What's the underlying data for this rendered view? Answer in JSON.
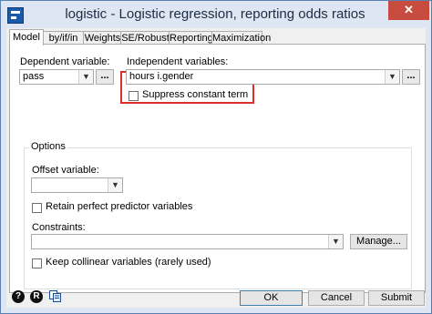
{
  "window": {
    "title": "logistic - Logistic regression, reporting odds ratios",
    "close_glyph": "✕"
  },
  "tabs": [
    "Model",
    "by/if/in",
    "Weights",
    "SE/Robust",
    "Reporting",
    "Maximization"
  ],
  "model": {
    "dep_label": "Dependent variable:",
    "dep_value": "pass",
    "indep_label": "Independent variables:",
    "indep_value": "hours i.gender",
    "suppress_label": "Suppress constant term",
    "dots_glyph": "..."
  },
  "options": {
    "title": "Options",
    "offset_label": "Offset variable:",
    "offset_value": "",
    "retain_label": "Retain perfect predictor variables",
    "constraints_label": "Constraints:",
    "constraints_value": "",
    "manage_label": "Manage...",
    "collinear_label": "Keep collinear variables (rarely used)"
  },
  "footer": {
    "help_glyph": "?",
    "reset_glyph": "R",
    "ok_label": "OK",
    "cancel_label": "Cancel",
    "submit_label": "Submit"
  },
  "colors": {
    "accent": "#d9302a",
    "close": "#c74b3e"
  }
}
